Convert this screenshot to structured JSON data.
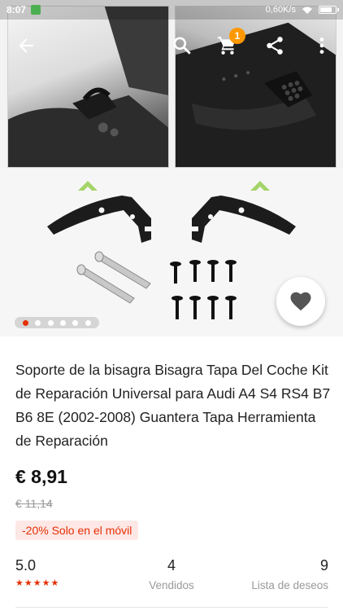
{
  "status_bar": {
    "time": "8:07",
    "network_speed": "0,60K/s",
    "battery_level": 0.8
  },
  "toolbar": {
    "cart_count": "1"
  },
  "gallery": {
    "pager_total": 6,
    "pager_active": 1
  },
  "product": {
    "title": "Soporte de la bisagra Bisagra Tapa Del Coche Kit de Reparación Universal para Audi A4 S4 RS4 B7 B6 8E (2002-2008) Guantera Tapa Herramienta de Reparación",
    "price": "€ 8,91",
    "old_price": "€ 11,14",
    "promo": "-20% Solo en el móvil"
  },
  "stats": {
    "rating": "5.0",
    "stars": "★★★★★",
    "sold_count": "4",
    "sold_label": "Vendidos",
    "wish_count": "9",
    "wish_label": "Lista de deseos"
  },
  "colors": {
    "accent": "#e62e04",
    "badge": "#ff9800",
    "arrow_green": "#a5d46a"
  }
}
